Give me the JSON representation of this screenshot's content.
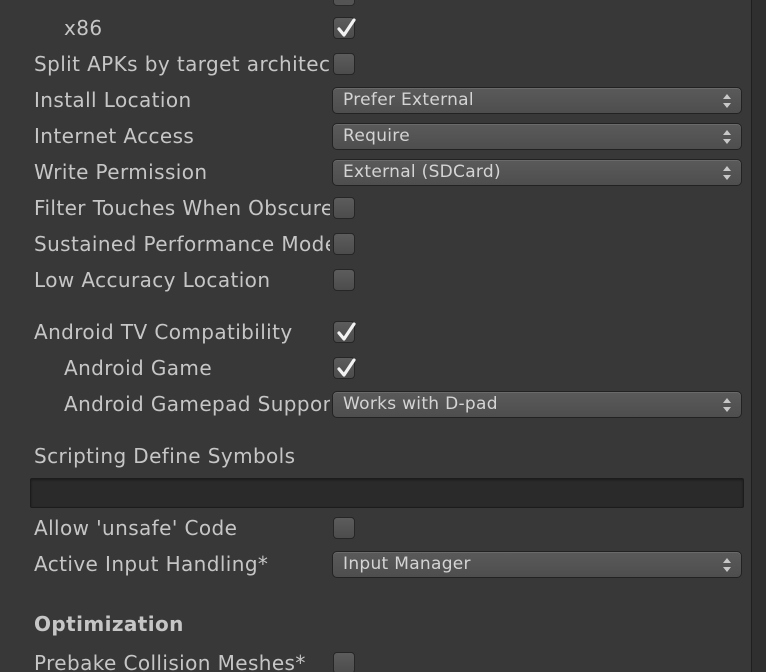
{
  "settings": {
    "x86": {
      "label": "x86",
      "checked": true
    },
    "split_apks": {
      "label": "Split APKs by target architecture",
      "checked": false
    },
    "install_location": {
      "label": "Install Location",
      "value": "Prefer External"
    },
    "internet_access": {
      "label": "Internet Access",
      "value": "Require"
    },
    "write_permission": {
      "label": "Write Permission",
      "value": "External (SDCard)"
    },
    "filter_touches": {
      "label": "Filter Touches When Obscured",
      "checked": false
    },
    "sustained_performance": {
      "label": "Sustained Performance Mode",
      "checked": false
    },
    "low_accuracy_location": {
      "label": "Low Accuracy Location",
      "checked": false
    },
    "android_tv": {
      "label": "Android TV Compatibility",
      "checked": true
    },
    "android_game": {
      "label": "Android Game",
      "checked": true
    },
    "gamepad_support": {
      "label": "Android Gamepad Support Level",
      "value": "Works with D-pad"
    },
    "scripting_define_symbols": {
      "label": "Scripting Define Symbols",
      "value": ""
    },
    "allow_unsafe_code": {
      "label": "Allow 'unsafe' Code",
      "checked": false
    },
    "active_input_handling": {
      "label": "Active Input Handling*",
      "value": "Input Manager"
    }
  },
  "optimization": {
    "header": "Optimization",
    "prebake_collision_meshes": {
      "label": "Prebake Collision Meshes*",
      "checked": false
    }
  },
  "colors": {
    "background": "#383838",
    "text": "#c6c6c6",
    "control": "#545454",
    "field": "#2a2a2a"
  }
}
